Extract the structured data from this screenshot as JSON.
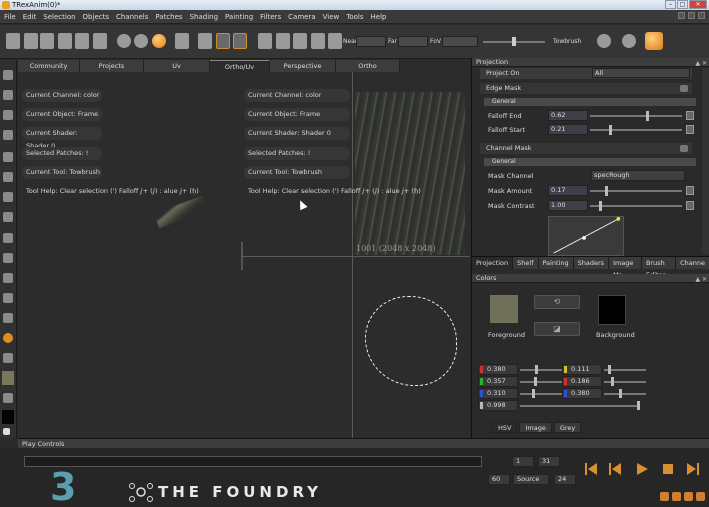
{
  "app": {
    "title": "TRexAnim(0)*",
    "menu": [
      "File",
      "Edit",
      "Selection",
      "Objects",
      "Channels",
      "Patches",
      "Shading",
      "Painting",
      "Filters",
      "Camera",
      "View",
      "Tools",
      "Help"
    ]
  },
  "toolbar": {
    "near_label": "Near",
    "far_label": "Far",
    "fov_label": "FoV",
    "brush_label": "Towbrush"
  },
  "viewport": {
    "tabs": [
      "Community",
      "Projects",
      "Uv",
      "Ortho/Uv",
      "Perspective",
      "Ortho"
    ],
    "active_tab": "Ortho/Uv",
    "left_info": {
      "channel": "Current Channel: color",
      "object": "Current Object: Frame",
      "shader": "Current Shader: Shader 0",
      "patches": "Selected Patches: !",
      "tool": "Current Tool: Towbrush",
      "help": "Tool Help: Clear selection (') Falloff ⅉ+ (ⅉ) : alue ⅉ+ (ḥ)"
    },
    "right_info": {
      "channel": "Current Channel: color",
      "object": "Current Object: Frame",
      "shader": "Current Shader: Shader 0",
      "patches": "Selected Patches: !",
      "tool": "Current Tool: Towbrush",
      "help": "Tool Help: Clear selection (') Falloff ⅉ+ (ⅉ) : alue ⅉ+ (ḥ)"
    },
    "texture_label": "1001 (2048 x 2048)"
  },
  "projection_panel": {
    "title": "Projection",
    "project_on_label": "Project On",
    "project_on_value": "All",
    "edge_mask": {
      "title": "Edge Mask",
      "general": "General",
      "falloff_end_label": "Falloff End",
      "falloff_end": "0.62",
      "falloff_end_level": 0.62,
      "falloff_start_label": "Falloff Start",
      "falloff_start": "0.21",
      "falloff_start_level": 0.21
    },
    "channel_mask": {
      "title": "Channel Mask",
      "general": "General",
      "mask_channel_label": "Mask Channel",
      "mask_channel": "specRough",
      "mask_amount_label": "Mask Amount",
      "mask_amount": "0.17",
      "mask_amount_level": 0.17,
      "mask_contrast_label": "Mask Contrast",
      "mask_contrast": "1.00",
      "mask_contrast_level": 0.1
    },
    "tabs": [
      "Projection",
      "Shelf",
      "Painting",
      "Shaders",
      "Image Ma...",
      "Brush Editor",
      "Channe"
    ]
  },
  "colors_panel": {
    "title": "Colors",
    "foreground_label": "Foreground",
    "background_label": "Background",
    "foreground_color": "#71705a",
    "background_color": "#000000",
    "fg_values": [
      {
        "value": "0.380",
        "color": "#d03030",
        "level": 0.38
      },
      {
        "value": "0.357",
        "color": "#30b030",
        "level": 0.357
      },
      {
        "value": "0.310",
        "color": "#3050d0",
        "level": 0.31
      },
      {
        "value": "0.998",
        "color": "#bbbbbb",
        "level": 0.998
      }
    ],
    "bg_values": [
      {
        "value": "0.111",
        "color": "#d0c030",
        "level": 0.111
      },
      {
        "value": "0.186",
        "color": "#d03030",
        "level": 0.186
      },
      {
        "value": "0.380",
        "color": "#3050d0",
        "level": 0.38
      }
    ],
    "tabs": [
      "HSV",
      "Image",
      "Grey"
    ]
  },
  "play_controls": {
    "title": "Play Controls",
    "frame_start": "1",
    "frame_end": "31",
    "fps": "60",
    "source": "Source",
    "step": "24"
  },
  "branding": {
    "wordmark": "THE FOUNDRY"
  }
}
